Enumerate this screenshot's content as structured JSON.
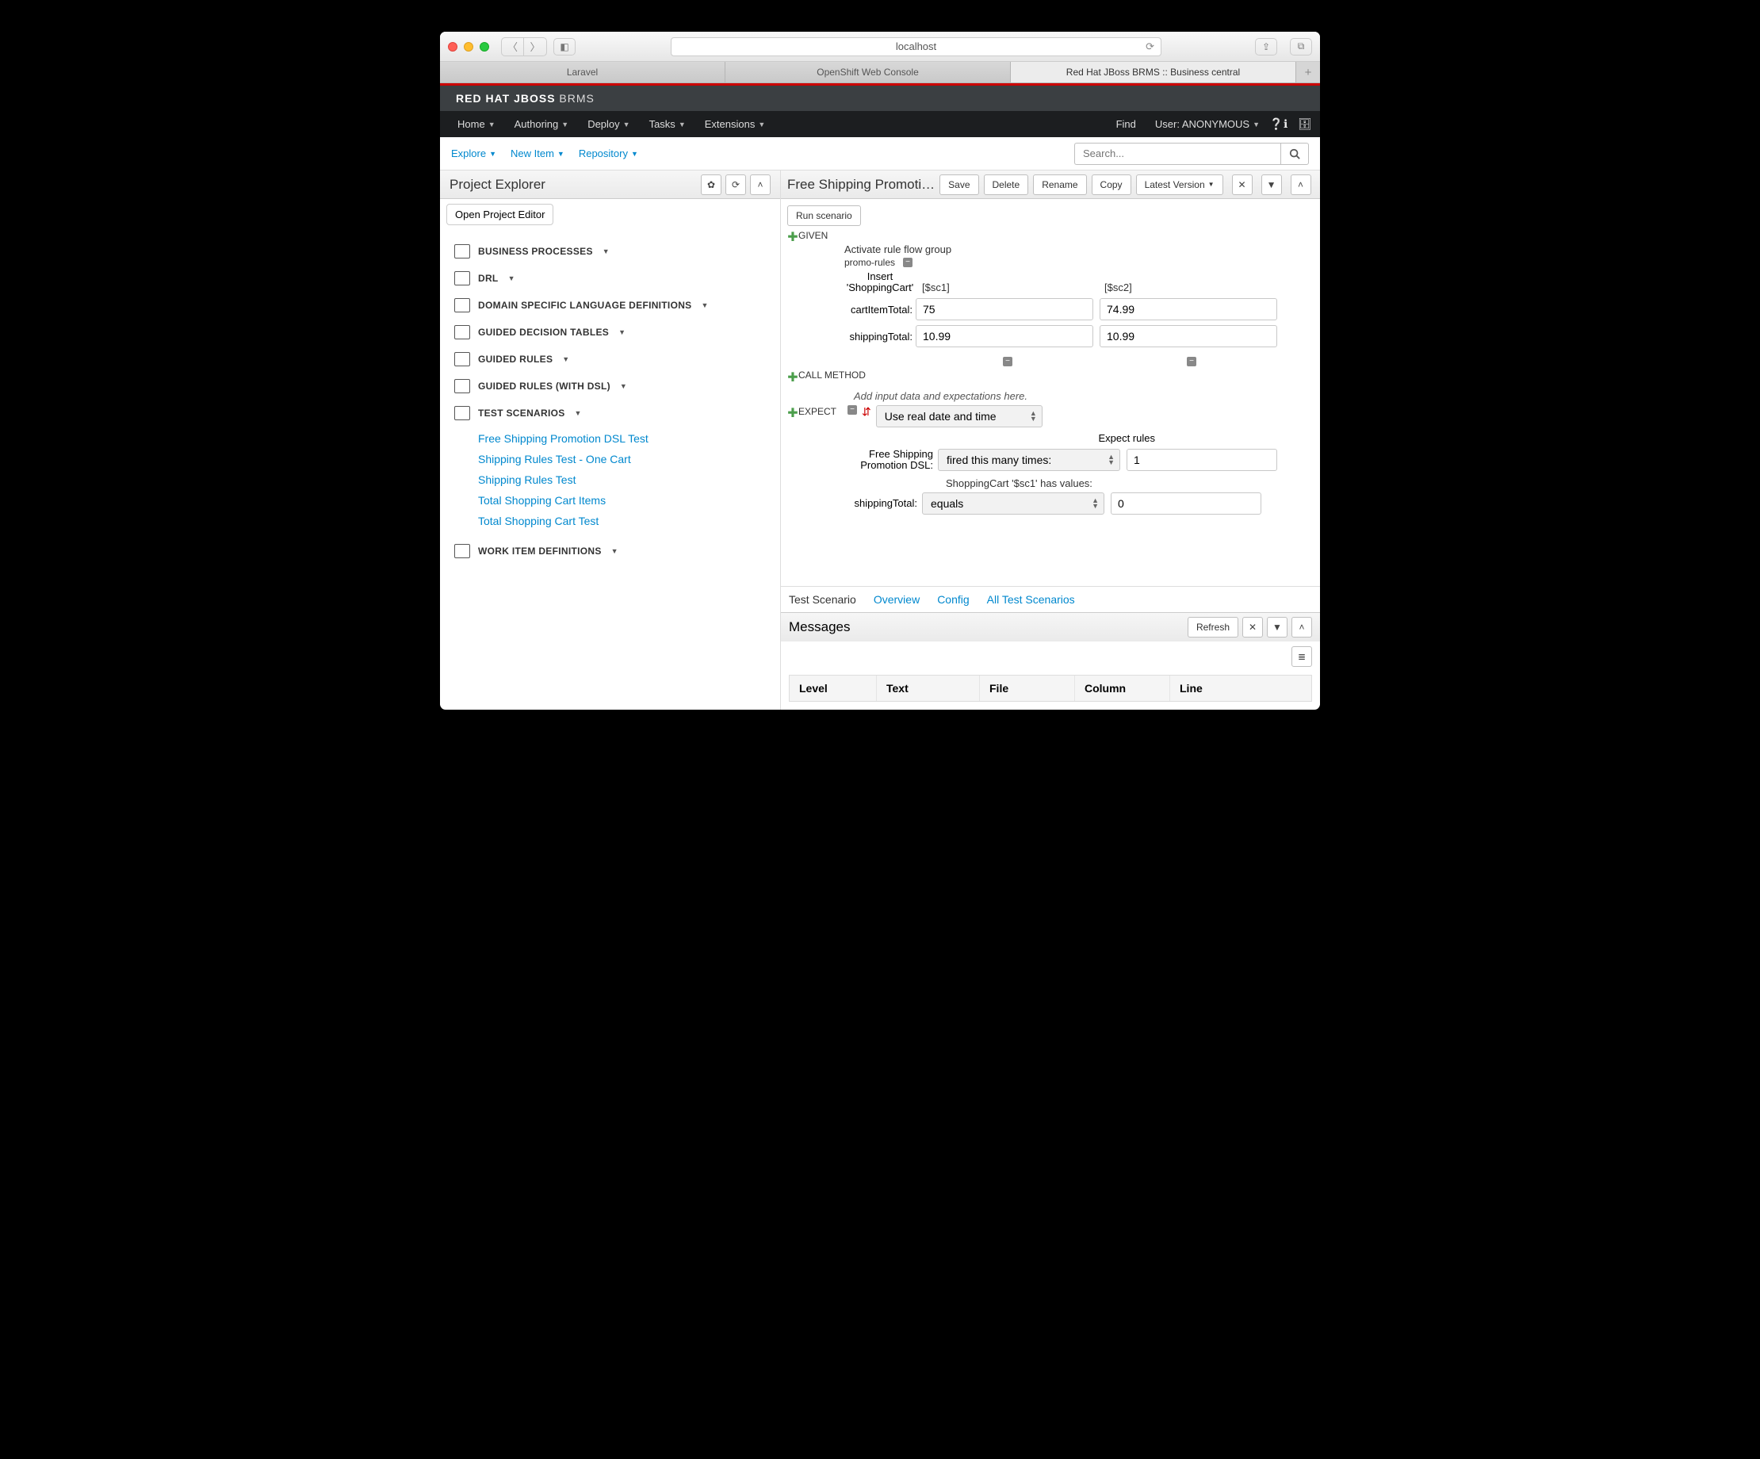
{
  "browser": {
    "address": "localhost",
    "tabs": [
      "Laravel",
      "OpenShift Web Console",
      "Red Hat JBoss BRMS :: Business central"
    ],
    "active_tab": 2
  },
  "brand": {
    "bold": "RED HAT JBOSS",
    "thin": " BRMS"
  },
  "menubar": {
    "items": [
      "Home",
      "Authoring",
      "Deploy",
      "Tasks",
      "Extensions"
    ],
    "find": "Find",
    "user": "User: ANONYMOUS"
  },
  "subbar": {
    "items": [
      "Explore",
      "New Item",
      "Repository"
    ],
    "search_placeholder": "Search..."
  },
  "explorer": {
    "title": "Project Explorer",
    "open_editor": "Open Project Editor",
    "groups": [
      {
        "label": "BUSINESS PROCESSES"
      },
      {
        "label": "DRL"
      },
      {
        "label": "DOMAIN SPECIFIC LANGUAGE DEFINITIONS"
      },
      {
        "label": "GUIDED DECISION TABLES"
      },
      {
        "label": "GUIDED RULES"
      },
      {
        "label": "GUIDED RULES (WITH DSL)"
      },
      {
        "label": "TEST SCENARIOS",
        "expanded": true,
        "children": [
          "Free Shipping Promotion DSL Test",
          "Shipping Rules Test - One Cart",
          "Shipping Rules Test",
          "Total Shopping Cart Items",
          "Total Shopping Cart Test"
        ]
      },
      {
        "label": "WORK ITEM DEFINITIONS"
      }
    ]
  },
  "editor": {
    "title": "Free Shipping Promoti…",
    "actions": {
      "save": "Save",
      "delete": "Delete",
      "rename": "Rename",
      "copy": "Copy",
      "version": "Latest Version"
    },
    "run": "Run scenario",
    "given": {
      "label": "GIVEN",
      "ruleflow_title": "Activate rule flow group",
      "ruleflow_value": "promo-rules",
      "insert_label": "Insert 'ShoppingCart'",
      "cols": [
        "[$sc1]",
        "[$sc2]"
      ],
      "rows": [
        {
          "label": "cartItemTotal:",
          "v1": "75",
          "v2": "74.99"
        },
        {
          "label": "shippingTotal:",
          "v1": "10.99",
          "v2": "10.99"
        }
      ]
    },
    "call": {
      "label": "CALL METHOD",
      "hint": "Add input data and expectations here."
    },
    "expect": {
      "label": "EXPECT",
      "date_mode": "Use real date and time",
      "rules_header": "Expect rules",
      "rule_name": "Free Shipping Promotion DSL:",
      "rule_op": "fired this many times:",
      "rule_count": "1",
      "fact_header": "ShoppingCart '$sc1' has values:",
      "fact_label": "shippingTotal:",
      "fact_op": "equals",
      "fact_val": "0"
    },
    "tabs": [
      "Test Scenario",
      "Overview",
      "Config",
      "All Test Scenarios"
    ],
    "active_tab": 0
  },
  "messages": {
    "title": "Messages",
    "refresh": "Refresh",
    "columns": [
      "Level",
      "Text",
      "File",
      "Column",
      "Line"
    ]
  }
}
